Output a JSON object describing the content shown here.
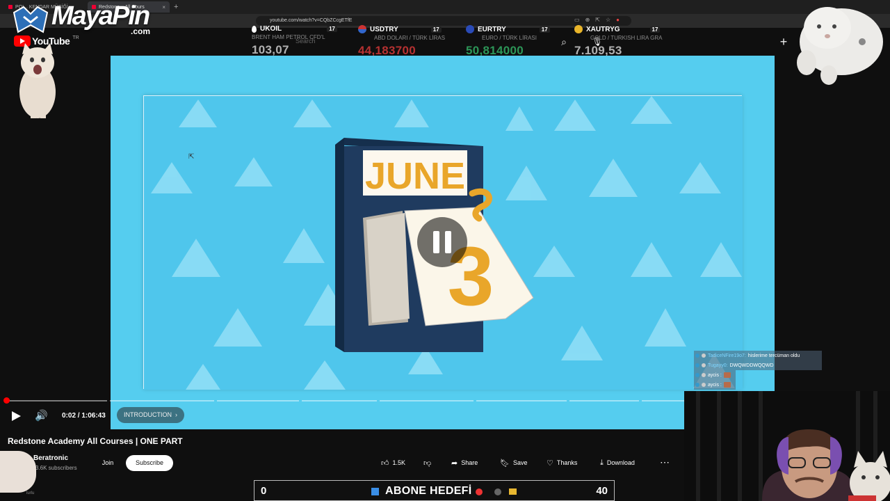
{
  "browser": {
    "tabs": [
      {
        "title": "POI... KENDAR MÜSİĞİ -"
      },
      {
        "title": "Redstone... All Cours"
      }
    ],
    "tab_close": "×",
    "new_tab": "+",
    "url": "youtube.com/watch?v=CQbZCcgETfE"
  },
  "youtube": {
    "logo_text": "YouTube",
    "region": "TR",
    "search_placeholder": "Search"
  },
  "overlay_logo": {
    "name": "MayaPin",
    "domain": ".com"
  },
  "tickers": [
    {
      "symbol": "UKOIL",
      "name": "BRENT HAM PETROL CFD'L",
      "value": "103,07",
      "color": "#e8e8e8",
      "tv": "17"
    },
    {
      "symbol": "USDTRY",
      "name": "ABD DOLARI / TÜRK LİRAS",
      "value": "44,183700",
      "color": "#e03a3a",
      "tv": "17"
    },
    {
      "symbol": "EURTRY",
      "name": "EURO / TÜRK LİRASI",
      "value": "50,814000",
      "color": "#34b76a",
      "tv": "17"
    },
    {
      "symbol": "XAUTRYG",
      "name": "GOLD / TURKISH LIRA GRA",
      "value": "7.109,53",
      "color": "#e8e8e8",
      "tv": "17"
    }
  ],
  "video": {
    "calendar_month": "JUNE",
    "calendar_day": "3",
    "state": "playing",
    "time_current": "0:02",
    "time_total": "1:06:43",
    "time_display": "0:02 / 1:06:43",
    "chapter": "INTRODUCTION",
    "progress_fraction": 0.0005
  },
  "info": {
    "title": "Redstone Academy All Courses | ONE PART",
    "channel": "Beratronic",
    "subscribers": "3.6K subscribers",
    "join": "Join",
    "subscribe": "Subscribe",
    "likes": "1.5K",
    "share": "Share",
    "save": "Save",
    "thanks": "Thanks",
    "download": "Download",
    "footnote": "lurlu"
  },
  "goal": {
    "current": "0",
    "target": "40",
    "title": "ABONE HEDEFİ"
  },
  "chat": [
    {
      "user": "TadiceNFire19o7:",
      "message": "hislerime tercüman oldu"
    },
    {
      "user": "Tugayy0:",
      "message": "DWQWDDWQQWD"
    },
    {
      "user": "aycis :",
      "message": ""
    },
    {
      "user": "aycis :",
      "message": ""
    }
  ],
  "colors": {
    "video_bg": "#55cdef",
    "triangle": "#8fdef6",
    "calendar_dark": "#1f3b5f",
    "calendar_gold": "#e9a62a",
    "accent_red": "#ff0000"
  }
}
